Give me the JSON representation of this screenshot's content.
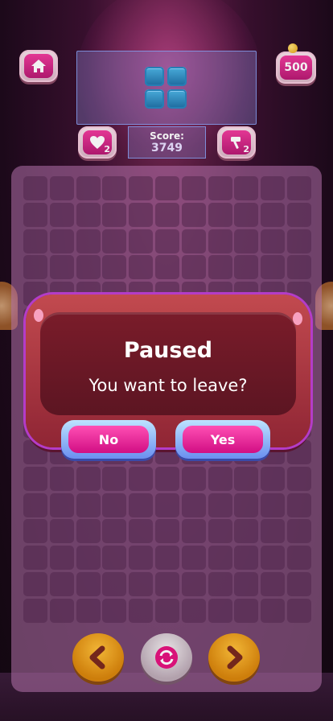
{
  "header": {
    "coins": "500",
    "hearts_count": "2",
    "hammer_count": "2",
    "score_label": "Score:",
    "score_value": "3749"
  },
  "board": {
    "columns": 11,
    "rows": 17
  },
  "dialog": {
    "title": "Paused",
    "message": "You want to leave?",
    "no_label": "No",
    "yes_label": "Yes"
  },
  "icons": [
    "home-icon",
    "coin-icon",
    "heart-icon",
    "hammer-icon",
    "back-arrow-icon",
    "restart-icon",
    "next-arrow-icon"
  ],
  "colors": {
    "accent": "#e4137f",
    "dialog": "#8f2534",
    "button_blue": "#6a8ff0",
    "control_orange": "#f2a51e"
  }
}
